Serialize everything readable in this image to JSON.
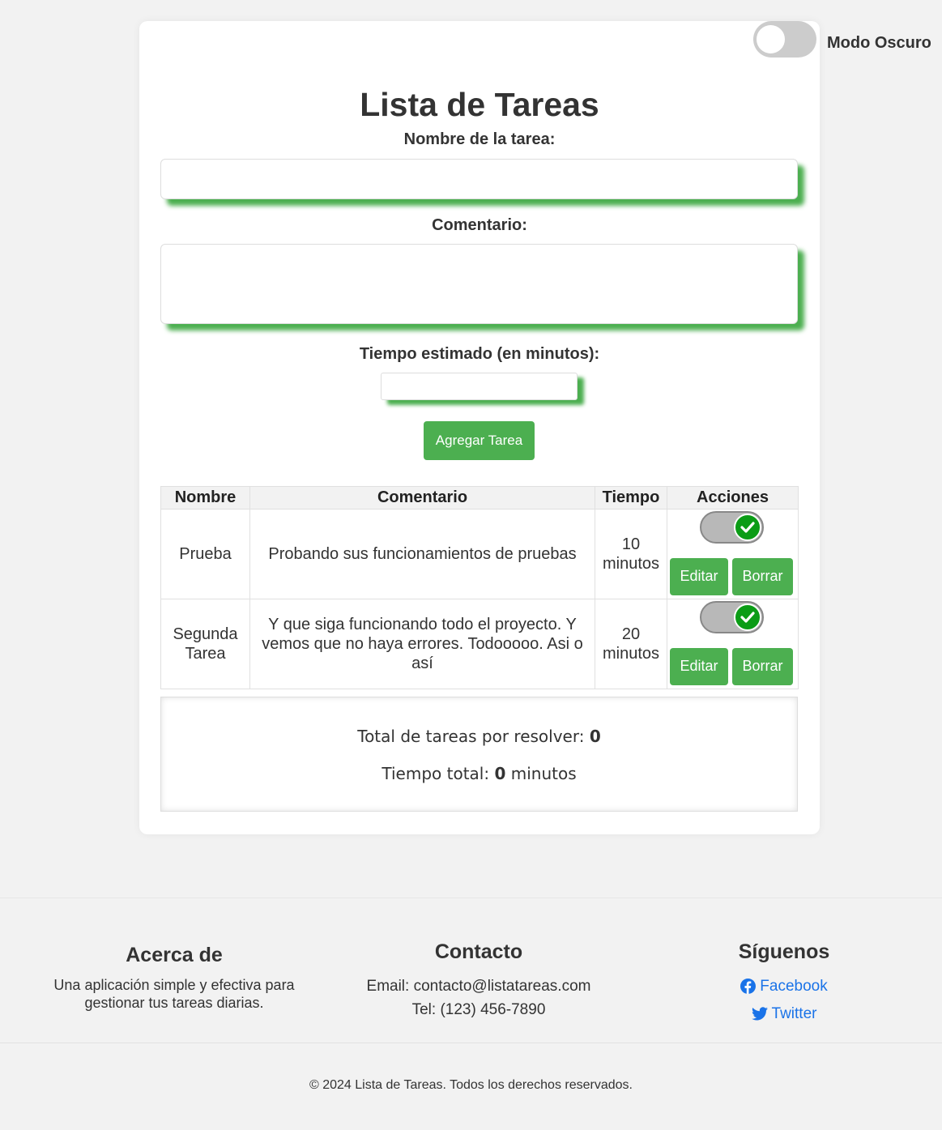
{
  "header": {
    "title": "Lista de Tareas",
    "dark_mode_label": "Modo Oscuro",
    "dark_mode_on": false
  },
  "form": {
    "name_label": "Nombre de la tarea:",
    "name_value": "",
    "comment_label": "Comentario:",
    "comment_value": "",
    "time_label": "Tiempo estimado (en minutos):",
    "time_value": "",
    "add_button": "Agregar Tarea"
  },
  "table": {
    "headers": [
      "Nombre",
      "Comentario",
      "Tiempo",
      "Acciones"
    ],
    "rows": [
      {
        "name": "Prueba",
        "comment": "Probando sus funcionamientos de pruebas",
        "time": "10 minutos",
        "done": true,
        "edit": "Editar",
        "delete": "Borrar"
      },
      {
        "name": "Segunda Tarea",
        "comment": "Y que siga funcionando todo el proyecto. Y vemos que no haya errores. Todooooo. Asi o así",
        "time": "20 minutos",
        "done": true,
        "edit": "Editar",
        "delete": "Borrar"
      }
    ]
  },
  "summary": {
    "pending_label": "Total de tareas por resolver:",
    "pending_value": "0",
    "time_label": "Tiempo total:",
    "time_value": "0",
    "time_unit": "minutos"
  },
  "footer": {
    "about_title": "Acerca de",
    "about_text": "Una aplicación simple y efectiva para gestionar tus tareas diarias.",
    "contact_title": "Contacto",
    "contact_email": "Email: contacto@listatareas.com",
    "contact_phone": "Tel: (123) 456-7890",
    "follow_title": "Síguenos",
    "facebook_label": "Facebook",
    "twitter_label": "Twitter",
    "copyright": "© 2024 Lista de Tareas. Todos los derechos reservados."
  },
  "colors": {
    "accent": "#4caf50",
    "link": "#1a73e8",
    "check": "#0b9c16"
  },
  "icons": [
    "facebook-icon",
    "twitter-icon",
    "check-icon"
  ]
}
